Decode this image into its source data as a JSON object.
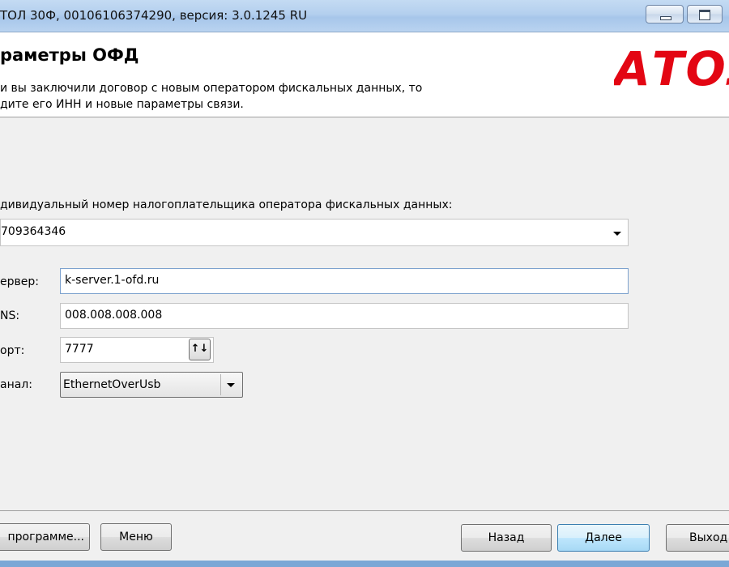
{
  "window": {
    "title": "ТОЛ 30Ф, 00106106374290, версия: 3.0.1245 RU"
  },
  "header": {
    "title": "раметры ОФД",
    "description_line1": "и вы заключили договор с новым оператором фискальных данных, то",
    "description_line2": "дите его ИНН и новые параметры связи.",
    "logo_text": "АТОЛ",
    "logo_color": "#e30613"
  },
  "form": {
    "inn_label": "дивидуальный номер налогоплательщика оператора фискальных данных:",
    "inn_value": "709364346",
    "server_label": "ервер:",
    "server_value": "k-server.1-ofd.ru",
    "dns_label": "NS:",
    "dns_value": "008.008.008.008",
    "port_label": "орт:",
    "port_value": "7777",
    "spin_glyph": "↑↓",
    "channel_label": "анал:",
    "channel_value": "EthernetOverUsb"
  },
  "footer": {
    "about_label": "программе...",
    "menu_label": "Меню",
    "back_label": "Назад",
    "next_label": "Далее",
    "exit_label": "Выход"
  },
  "icons": [
    "minimize-icon",
    "maximize-icon",
    "dropdown-arrow-icon",
    "spin-arrows-icon"
  ]
}
